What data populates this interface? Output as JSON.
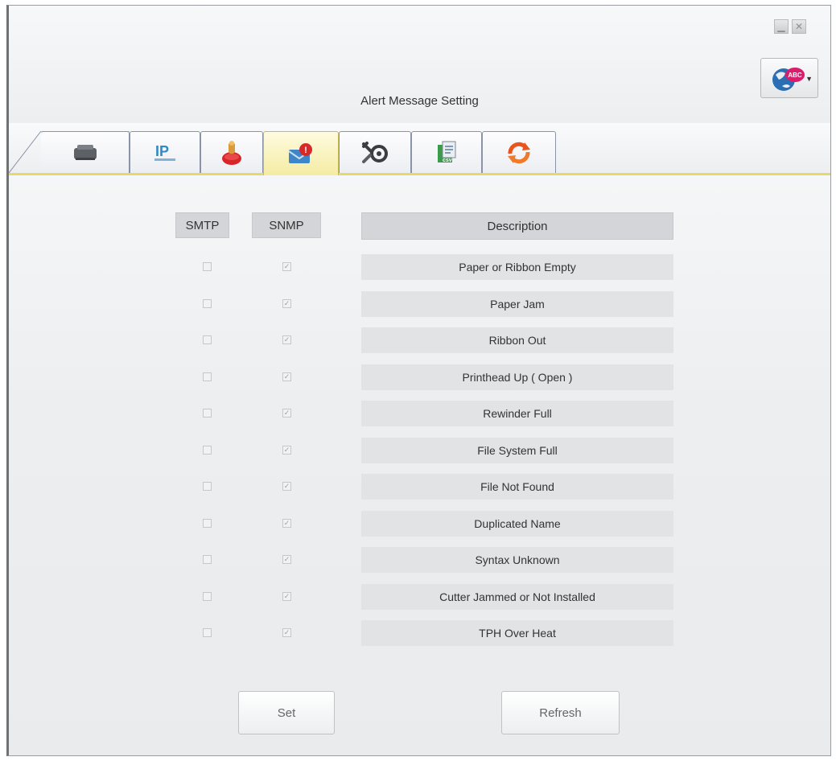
{
  "window": {
    "title": "Alert Message Setting",
    "minimize_glyph": "▁",
    "close_glyph": "✕"
  },
  "language_button": {
    "badge_text": "ABC",
    "icon": "globe-icon"
  },
  "tabs": [
    {
      "name": "printer",
      "icon": "printer-icon"
    },
    {
      "name": "ip-setting",
      "icon": "ip-icon",
      "text": "IP"
    },
    {
      "name": "beacon",
      "icon": "alarm-beacon-icon"
    },
    {
      "name": "alert-message",
      "icon": "mail-alert-icon",
      "active": true
    },
    {
      "name": "tools",
      "icon": "tools-icon"
    },
    {
      "name": "file",
      "icon": "file-icon"
    },
    {
      "name": "sync",
      "icon": "refresh-arrows-icon"
    }
  ],
  "table": {
    "headers": {
      "smtp": "SMTP",
      "snmp": "SNMP",
      "description": "Description"
    },
    "rows": [
      {
        "smtp": false,
        "snmp": true,
        "description": "Paper or Ribbon Empty"
      },
      {
        "smtp": false,
        "snmp": true,
        "description": "Paper Jam"
      },
      {
        "smtp": false,
        "snmp": true,
        "description": "Ribbon Out"
      },
      {
        "smtp": false,
        "snmp": true,
        "description": "Printhead Up ( Open )"
      },
      {
        "smtp": false,
        "snmp": true,
        "description": "Rewinder Full"
      },
      {
        "smtp": false,
        "snmp": true,
        "description": "File System Full"
      },
      {
        "smtp": false,
        "snmp": true,
        "description": "File Not Found"
      },
      {
        "smtp": false,
        "snmp": true,
        "description": "Duplicated Name"
      },
      {
        "smtp": false,
        "snmp": true,
        "description": "Syntax Unknown"
      },
      {
        "smtp": false,
        "snmp": true,
        "description": "Cutter Jammed or Not Installed"
      },
      {
        "smtp": false,
        "snmp": true,
        "description": "TPH Over Heat"
      }
    ]
  },
  "buttons": {
    "set": "Set",
    "refresh": "Refresh"
  },
  "colors": {
    "active_tab": "#f4eca2",
    "tab_underline": "#e8d86a",
    "header_bg": "#d3d5d8"
  }
}
